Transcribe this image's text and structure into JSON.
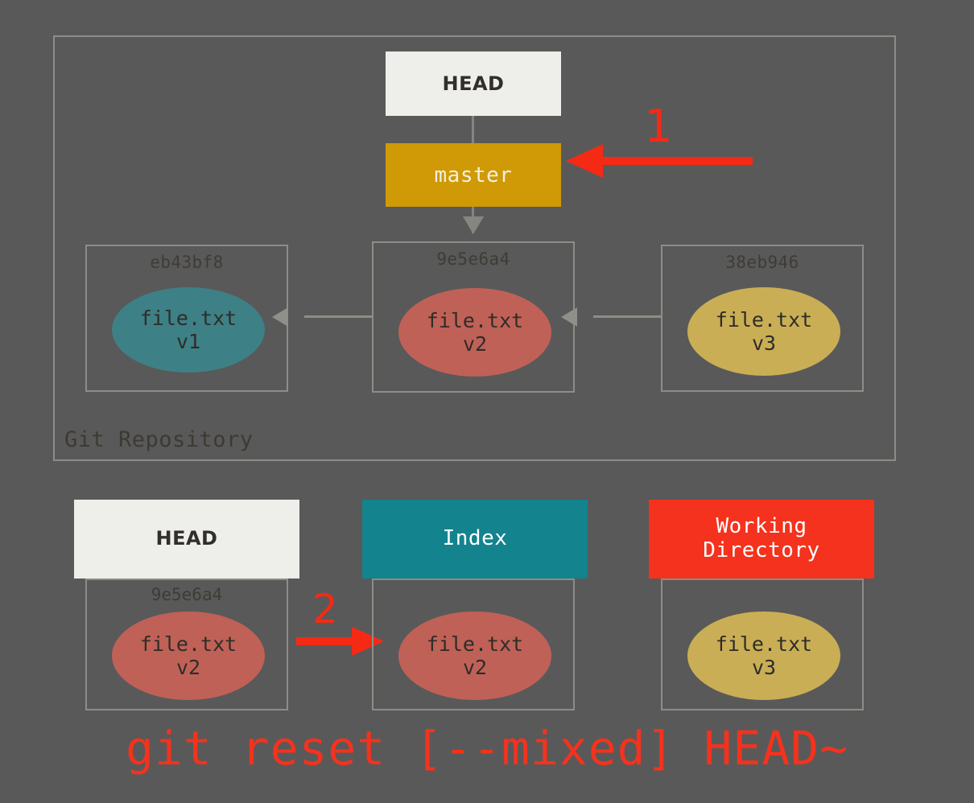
{
  "background_color": "#595959",
  "repository": {
    "label": "Git Repository",
    "refs": {
      "head_label": "HEAD",
      "branch_label": "master"
    },
    "commits": [
      {
        "hash": "eb43bf8",
        "file_name": "file.txt",
        "file_version": "v1",
        "blob_color": "#3d8086"
      },
      {
        "hash": "9e5e6a4",
        "file_name": "file.txt",
        "file_version": "v2",
        "blob_color": "#bf6157"
      },
      {
        "hash": "38eb946",
        "file_name": "file.txt",
        "file_version": "v3",
        "blob_color": "#c9ae55"
      }
    ]
  },
  "areas": [
    {
      "title": "HEAD",
      "header_color": "#eeeeea",
      "hash": "9e5e6a4",
      "file_name": "file.txt",
      "file_version": "v2",
      "blob_color": "#bf6157"
    },
    {
      "title": "Index",
      "header_color": "#13838e",
      "hash": "",
      "file_name": "file.txt",
      "file_version": "v2",
      "blob_color": "#bf6157"
    },
    {
      "title": "Working\nDirectory",
      "title_line1": "Working",
      "title_line2": "Directory",
      "header_color": "#f4321d",
      "hash": "",
      "file_name": "file.txt",
      "file_version": "v3",
      "blob_color": "#c9ae55"
    }
  ],
  "annotations": {
    "step_one": "1",
    "step_two": "2",
    "accent_color": "#f42a15"
  },
  "caption": "git reset [--mixed] HEAD~"
}
